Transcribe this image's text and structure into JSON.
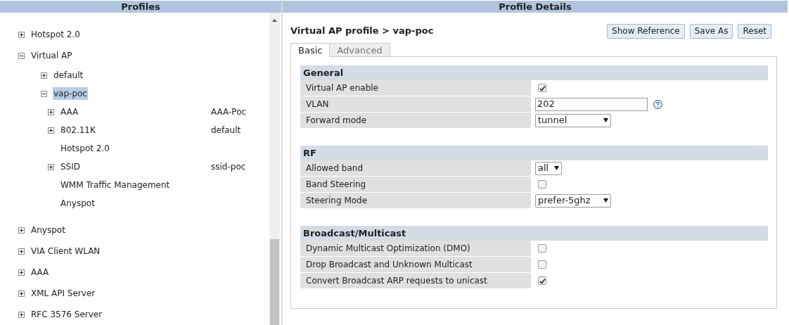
{
  "profiles": {
    "title": "Profiles",
    "tree": [
      {
        "label": "Hotspot 2.0",
        "kind": "node",
        "expanded": false,
        "selected": false
      },
      {
        "label": "Virtual AP",
        "kind": "node",
        "expanded": true,
        "selected": false,
        "children": [
          {
            "label": "default",
            "kind": "node",
            "expanded": false,
            "selected": false
          },
          {
            "label": "vap-poc",
            "kind": "node",
            "expanded": true,
            "selected": true,
            "children": [
              {
                "label": "AAA",
                "value": "AAA-Poc",
                "kind": "node",
                "expanded": false,
                "selected": false
              },
              {
                "label": "802.11K",
                "value": "default",
                "kind": "node",
                "expanded": false,
                "selected": false
              },
              {
                "label": "Hotspot 2.0",
                "kind": "leaf",
                "selected": false
              },
              {
                "label": "SSID",
                "value": "ssid-poc",
                "kind": "node",
                "expanded": false,
                "selected": false
              },
              {
                "label": "WMM Traffic Management",
                "kind": "leaf",
                "selected": false
              },
              {
                "label": "Anyspot",
                "kind": "leaf",
                "selected": false
              }
            ]
          }
        ]
      },
      {
        "label": "Anyspot",
        "kind": "node",
        "expanded": false,
        "selected": false
      },
      {
        "label": "VIA Client WLAN",
        "kind": "node",
        "expanded": false,
        "selected": false
      },
      {
        "label": "AAA",
        "kind": "node",
        "expanded": false,
        "selected": false
      },
      {
        "label": "XML API Server",
        "kind": "node",
        "expanded": false,
        "selected": false
      },
      {
        "label": "RFC 3576 Server",
        "kind": "node",
        "expanded": false,
        "selected": false
      }
    ]
  },
  "details": {
    "title": "Profile Details",
    "breadcrumb": "Virtual AP profile > vap-poc",
    "buttons": [
      "Show Reference",
      "Save As",
      "Reset"
    ],
    "tabs": [
      {
        "label": "Basic",
        "selected": true
      },
      {
        "label": "Advanced",
        "selected": false
      }
    ],
    "sections": [
      {
        "title": "General",
        "fields": [
          {
            "label": "Virtual AP enable",
            "kind": "checkbox",
            "checked": true,
            "help": false
          },
          {
            "label": "VLAN",
            "kind": "text",
            "value": "202",
            "help": true
          },
          {
            "label": "Forward mode",
            "kind": "select",
            "value": "tunnel",
            "help": false
          }
        ]
      },
      {
        "title": "RF",
        "fields": [
          {
            "label": "Allowed band",
            "kind": "select",
            "value": "all",
            "help": false
          },
          {
            "label": "Band Steering",
            "kind": "checkbox",
            "checked": false,
            "help": false
          },
          {
            "label": "Steering Mode",
            "kind": "select",
            "value": "prefer-5ghz",
            "help": false
          }
        ]
      },
      {
        "title": "Broadcast/Multicast",
        "fields": [
          {
            "label": "Dynamic Multicast Optimization (DMO)",
            "kind": "checkbox",
            "checked": false,
            "help": false
          },
          {
            "label": "Drop Broadcast and Unknown Multicast",
            "kind": "checkbox",
            "checked": false,
            "help": false
          },
          {
            "label": "Convert Broadcast ARP requests to unicast",
            "kind": "checkbox",
            "checked": true,
            "help": false
          }
        ]
      }
    ]
  }
}
